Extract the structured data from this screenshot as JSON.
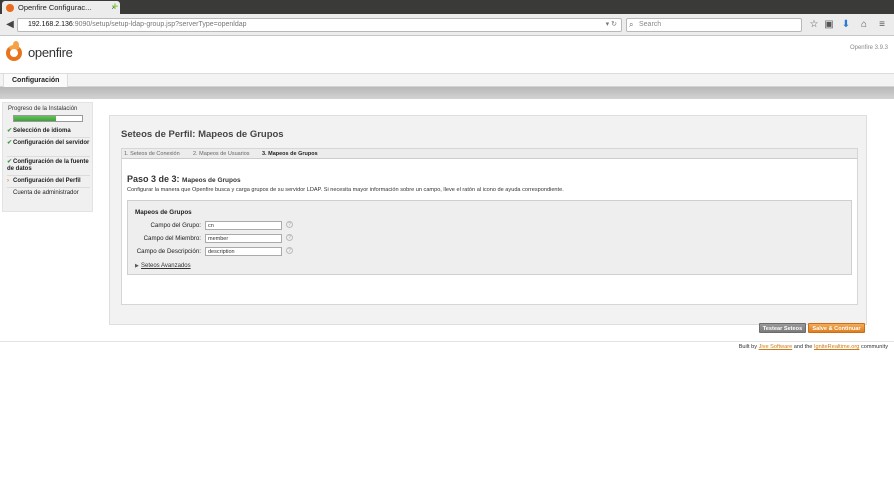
{
  "browser": {
    "tab_title": "Openfire Configurac...",
    "tab_close": "×",
    "new_tab": "+",
    "url_host": "192.168.2.136",
    "url_path": ":9090/setup/setup-ldap-group.jsp?serverType=openldap",
    "search_placeholder": "Search"
  },
  "header": {
    "logo_text": "openfire",
    "version": "Openfire 3.9.3"
  },
  "nav": {
    "tab_label": "Configuración"
  },
  "sidebar": {
    "title": "Progreso de la Instalación",
    "progress_percent": 62,
    "items": [
      {
        "label": "Selección de idioma",
        "status": "done"
      },
      {
        "label": "Configuración del servidor",
        "status": "done"
      },
      {
        "label": "Configuración de la fuente de datos",
        "status": "done"
      },
      {
        "label": "Configuración del Perfil",
        "status": "current"
      },
      {
        "label": "Cuenta de administrador",
        "status": "pending"
      }
    ]
  },
  "main": {
    "title": "Seteos de Perfil: Mapeos de Grupos",
    "steps": [
      {
        "label": "1. Seteos de Conexión"
      },
      {
        "label": "2. Mapeos de Usuarios"
      },
      {
        "label": "3. Mapeos de Grupos"
      }
    ],
    "paso_prefix": "Paso 3 de 3:",
    "paso_sub": "Mapeos de Grupos",
    "description": "Configurar la manera que Openfire busca y carga grupos de su servidor LDAP. Si necesita mayor información sobre un campo, lleve el ratón al icono de ayuda correspondiente.",
    "form": {
      "heading": "Mapeos de Grupos",
      "fields": [
        {
          "label": "Campo del Grupo:",
          "value": "cn"
        },
        {
          "label": "Campo del Miembro:",
          "value": "member"
        },
        {
          "label": "Campo de Descripción:",
          "value": "description"
        }
      ],
      "help_glyph": "?",
      "advanced_label": "Seteos Avanzados"
    },
    "buttons": {
      "test": "Testear Seteos",
      "save": "Salve & Continuar"
    }
  },
  "footer": {
    "prefix": "Built by",
    "link1": "Jive Software",
    "middle": "and the",
    "link2": "IgniteRealtime.org",
    "suffix": "community"
  },
  "colors": {
    "accent": "#e8731c",
    "progress_green": "#4fb34a",
    "save_button": "#e38a2a",
    "test_button": "#8a8a8a"
  }
}
